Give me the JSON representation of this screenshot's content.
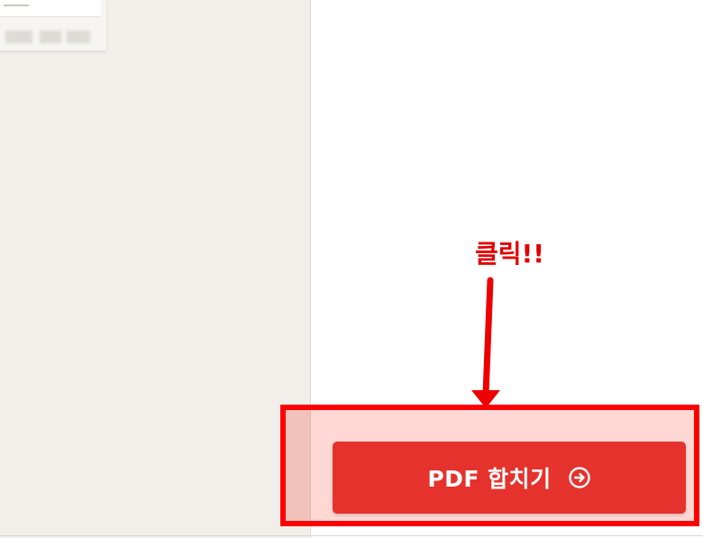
{
  "left_panel": {
    "thumbnail_text": "",
    "background": "#f2efea"
  },
  "action": {
    "merge_button_label": "PDF 합치기",
    "merge_button_icon": "arrow-right-circle-icon",
    "button_color": "#e5322d"
  },
  "annotation": {
    "callout_text": "클릭!!",
    "callout_color": "#e00000",
    "highlight_color": "#ff0000"
  }
}
